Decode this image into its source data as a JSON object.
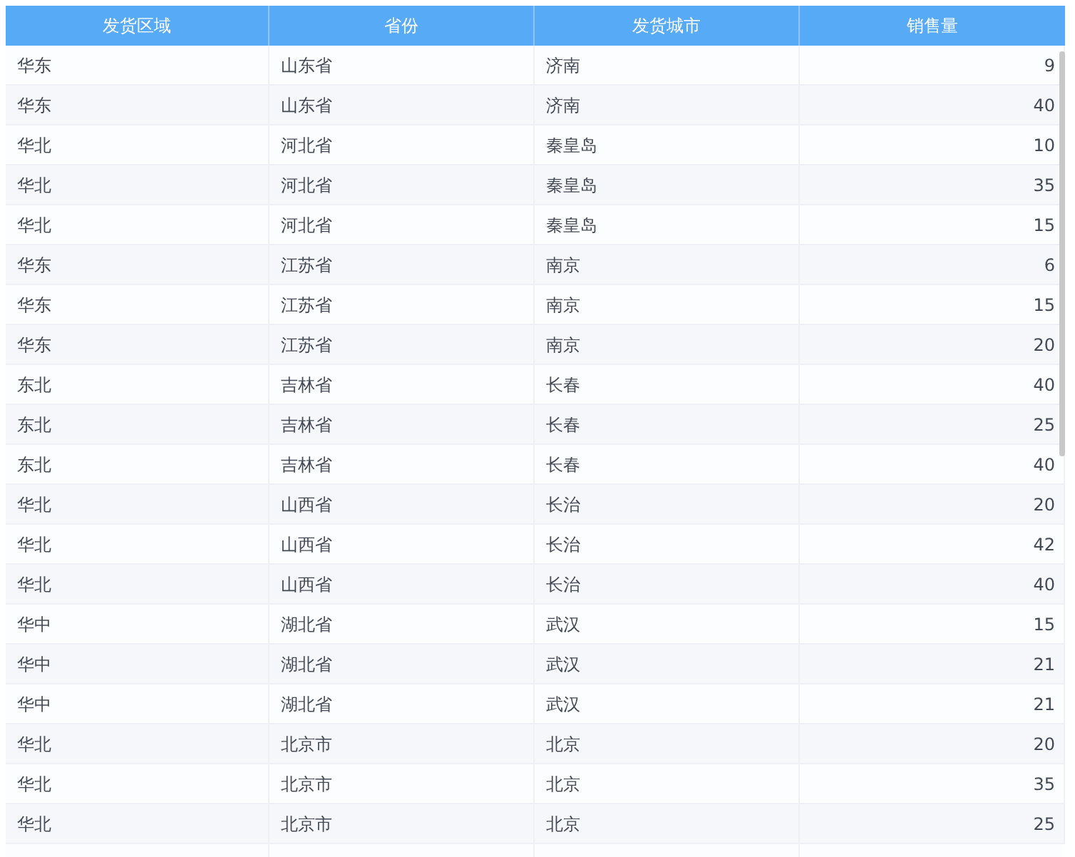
{
  "table": {
    "columns": [
      "发货区域",
      "省份",
      "发货城市",
      "销售量"
    ],
    "rows": [
      [
        "华东",
        "山东省",
        "济南",
        "9"
      ],
      [
        "华东",
        "山东省",
        "济南",
        "40"
      ],
      [
        "华北",
        "河北省",
        "秦皇岛",
        "10"
      ],
      [
        "华北",
        "河北省",
        "秦皇岛",
        "35"
      ],
      [
        "华北",
        "河北省",
        "秦皇岛",
        "15"
      ],
      [
        "华东",
        "江苏省",
        "南京",
        "6"
      ],
      [
        "华东",
        "江苏省",
        "南京",
        "15"
      ],
      [
        "华东",
        "江苏省",
        "南京",
        "20"
      ],
      [
        "东北",
        "吉林省",
        "长春",
        "40"
      ],
      [
        "东北",
        "吉林省",
        "长春",
        "25"
      ],
      [
        "东北",
        "吉林省",
        "长春",
        "40"
      ],
      [
        "华北",
        "山西省",
        "长治",
        "20"
      ],
      [
        "华北",
        "山西省",
        "长治",
        "42"
      ],
      [
        "华北",
        "山西省",
        "长治",
        "40"
      ],
      [
        "华中",
        "湖北省",
        "武汉",
        "15"
      ],
      [
        "华中",
        "湖北省",
        "武汉",
        "21"
      ],
      [
        "华中",
        "湖北省",
        "武汉",
        "21"
      ],
      [
        "华北",
        "北京市",
        "北京",
        "20"
      ],
      [
        "华北",
        "北京市",
        "北京",
        "35"
      ],
      [
        "华北",
        "北京市",
        "北京",
        "25"
      ]
    ]
  }
}
